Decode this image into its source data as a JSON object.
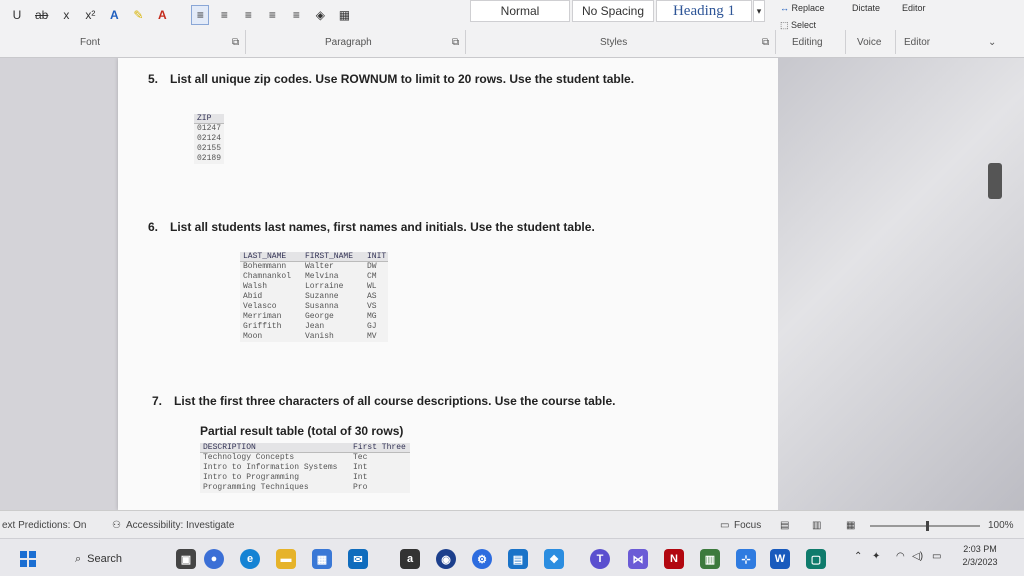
{
  "ribbon": {
    "font_tools": [
      "U",
      "ab",
      "x",
      "x²",
      "A",
      "A"
    ],
    "paragraph_tools": [
      "≡",
      "≡",
      "≡",
      "≡",
      "≡"
    ],
    "styles": {
      "normal": "Normal",
      "no_spacing": "No Spacing",
      "heading1": "Heading 1"
    },
    "replace_label": "Replace",
    "select_label": "Select",
    "dictate_label": "Dictate",
    "editor_label": "Editor",
    "groups": {
      "font": "Font",
      "paragraph": "Paragraph",
      "styles": "Styles",
      "editing": "Editing",
      "voice": "Voice",
      "editor": "Editor"
    }
  },
  "document": {
    "q5": {
      "num": "5.",
      "text": "List all unique zip codes. Use ROWNUM to limit to 20 rows. Use the student table."
    },
    "zip_table": {
      "header": "ZIP",
      "rows": [
        "01247",
        "02124",
        "02155",
        "02189"
      ]
    },
    "q6": {
      "num": "6.",
      "text": "List all students last names, first names and initials. Use the student table."
    },
    "names_table": {
      "headers": [
        "LAST_NAME",
        "FIRST_NAME",
        "INIT"
      ],
      "rows": [
        [
          "Bohemmann",
          "Walter",
          "DW"
        ],
        [
          "Chamnankol",
          "Melvina",
          "CM"
        ],
        [
          "Walsh",
          "Lorraine",
          "WL"
        ],
        [
          "Abid",
          "Suzanne",
          "AS"
        ],
        [
          "Velasco",
          "Susanna",
          "VS"
        ],
        [
          "Merriman",
          "George",
          "MG"
        ],
        [
          "Griffith",
          "Jean",
          "GJ"
        ],
        [
          "Moon",
          "Vanish",
          "MV"
        ]
      ]
    },
    "q7": {
      "num": "7.",
      "text": "List the first three characters of all course descriptions. Use the course table."
    },
    "partial_title": "Partial result table (total of 30 rows)",
    "course_table": {
      "headers": [
        "DESCRIPTION",
        "First Three"
      ],
      "rows": [
        [
          "Technology Concepts",
          "Tec"
        ],
        [
          "Intro to Information Systems",
          "Int"
        ],
        [
          "Intro to Programming",
          "Int"
        ],
        [
          "Programming Techniques",
          "Pro"
        ]
      ]
    }
  },
  "statusbar": {
    "text_predictions": "ext Predictions: On",
    "accessibility": "Accessibility: Investigate",
    "focus": "Focus",
    "zoom": "100%"
  },
  "taskbar": {
    "search_label": "Search",
    "time": "2:03 PM",
    "date": "2/3/2023"
  },
  "colors": {
    "accent": "#2b579a",
    "word_blue": "#185abd"
  }
}
